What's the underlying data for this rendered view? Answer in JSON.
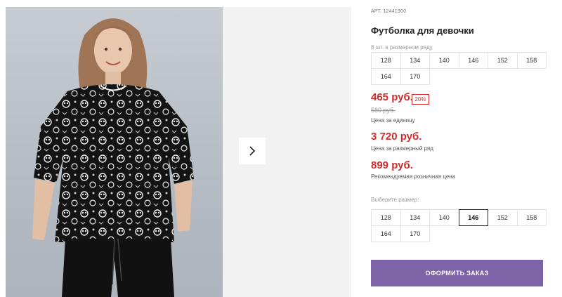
{
  "gallery": {
    "next_icon": "chevron-right-icon"
  },
  "product": {
    "article_label": "АРТ.",
    "article_value": "12441900",
    "title": "Футболка для девочки",
    "sizes_caption": "8 шт. в размерном ряду",
    "sizes_row": [
      "128",
      "134",
      "140",
      "146",
      "152",
      "158",
      "164",
      "170"
    ],
    "price": "465 руб.",
    "discount": "20%",
    "old_price": "580 руб.",
    "unit_price_label": "Цена за единицу",
    "series_price": "3 720 руб.",
    "series_price_label": "Цена за размерный ряд",
    "retail_price": "899 руб.",
    "retail_price_label": "Рекомендуемая розничная цена",
    "choose_size_label": "Выберите размер:",
    "size_options": [
      "128",
      "134",
      "140",
      "146",
      "152",
      "158",
      "164",
      "170"
    ],
    "selected_size": "146",
    "order_button": "ОФОРМИТЬ ЗАКАЗ"
  },
  "colors": {
    "price_red": "#d42a2a",
    "order_button": "#7e62a6"
  }
}
